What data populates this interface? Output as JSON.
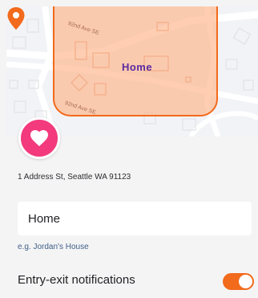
{
  "map": {
    "streets": [
      "92nd Ave SE",
      "92nd Ave SE"
    ],
    "place_label": "Home",
    "geofence_color": "#f26a1b",
    "pin_icon": "location-pin-icon"
  },
  "favorite": {
    "icon": "heart-icon",
    "color": "#f23a7c"
  },
  "address": "1 Address St, Seattle WA 91123",
  "name_field": {
    "value": "Home",
    "hint": "e.g. Jordan's House"
  },
  "notifications": {
    "label": "Entry-exit notifications",
    "enabled": true,
    "accent": "#f26a1b"
  }
}
